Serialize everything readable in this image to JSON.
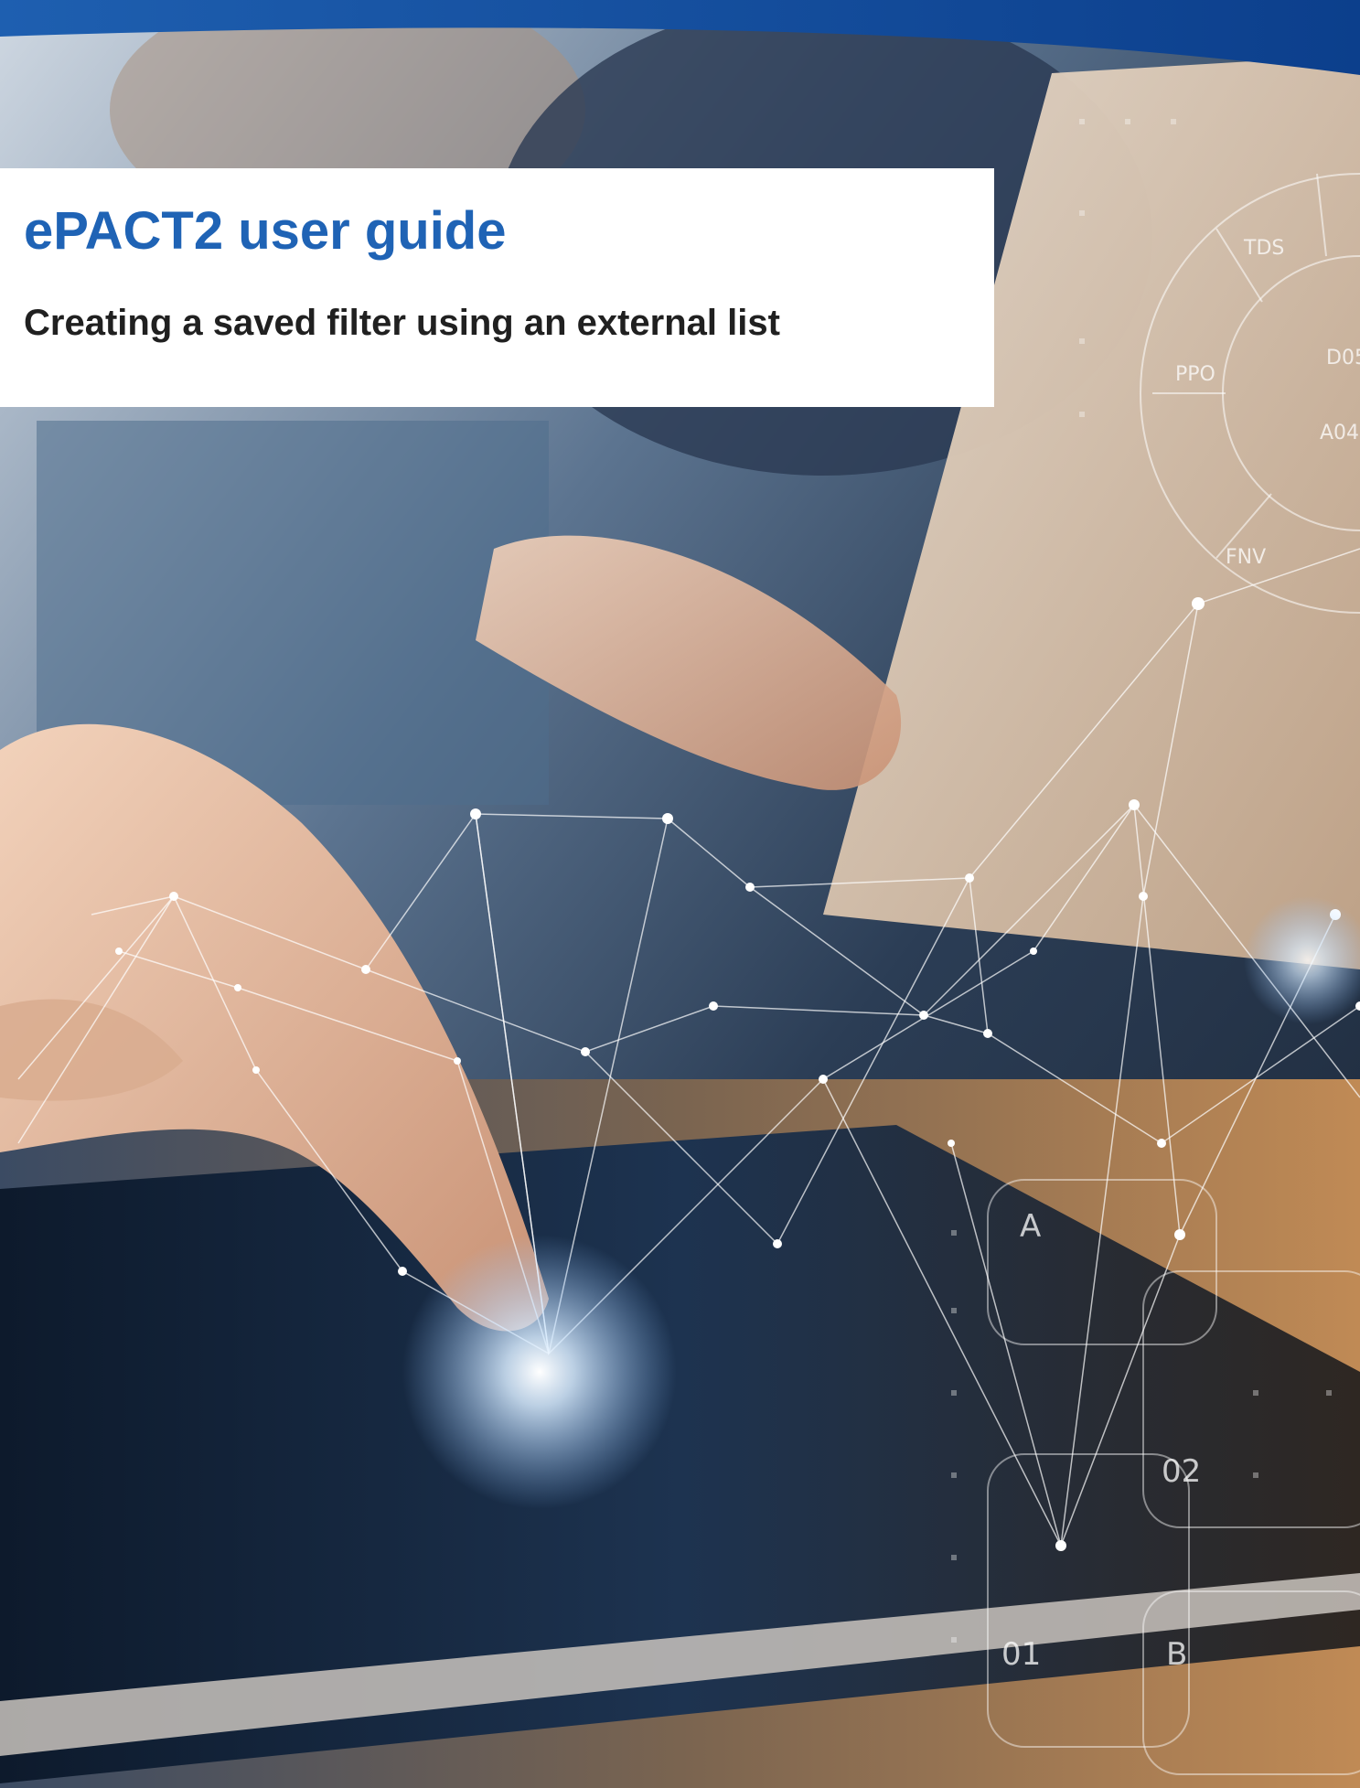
{
  "document": {
    "title": "ePACT2 user guide",
    "subtitle": "Creating a saved filter using an external list"
  },
  "cover_image": {
    "description_icon": "hand-touching-tablet-with-network-overlay",
    "hud_labels": [
      "TDS",
      "PPO",
      "D05",
      "A04",
      "FNV",
      "A",
      "02",
      "01",
      "B"
    ]
  },
  "colors": {
    "brand_blue": "#1f63b5",
    "title_text": "#1f63b5",
    "subtitle_text": "#202020",
    "banner_bg": "#ffffff"
  }
}
